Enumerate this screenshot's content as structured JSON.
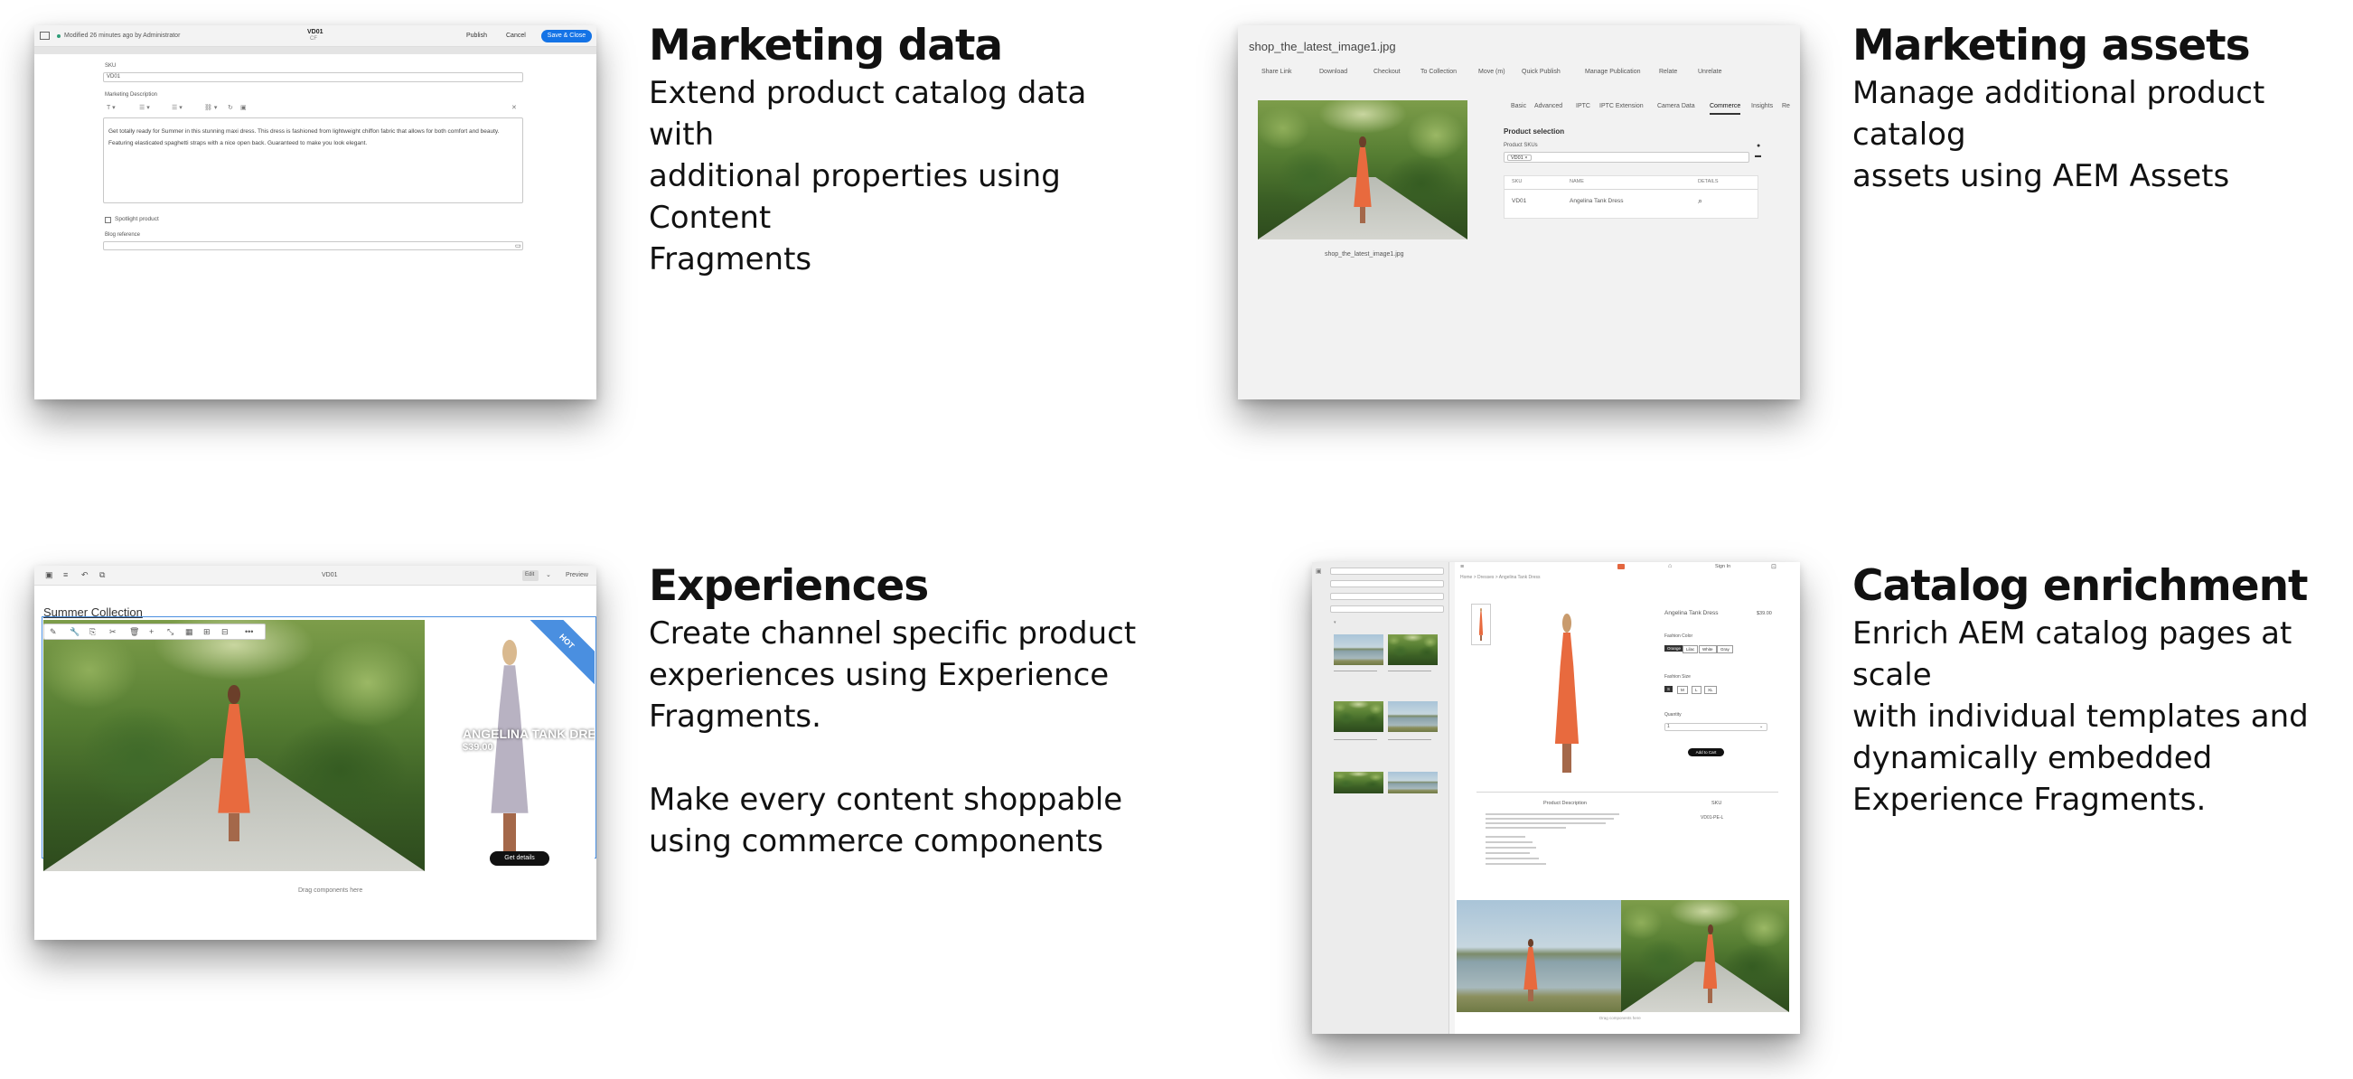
{
  "features": [
    {
      "id": "marketing-data",
      "title": "Marketing data",
      "body": [
        "Extend product catalog data with",
        "additional properties using Content",
        "Fragments"
      ]
    },
    {
      "id": "marketing-assets",
      "title": "Marketing assets",
      "body": [
        "Manage additional product catalog",
        "assets using AEM Assets"
      ]
    },
    {
      "id": "experiences",
      "title": "Experiences",
      "body": [
        "Create channel specific product",
        "experiences using Experience",
        "Fragments."
      ],
      "body2": [
        "Make every content shoppable",
        "using commerce components"
      ]
    },
    {
      "id": "catalog-enrichment",
      "title": "Catalog enrichment",
      "body": [
        "Enrich AEM catalog pages at scale",
        "with individual templates and",
        "dynamically embedded",
        "Experience Fragments."
      ]
    }
  ],
  "shot1": {
    "modified": "Modified 26 minutes ago by Administrator",
    "doc_title": "VD01",
    "doc_sub": "CF",
    "publish": "Publish",
    "cancel": "Cancel",
    "save_close": "Save & Close",
    "sku_label": "SKU",
    "sku_value": "VD01",
    "desc_label": "Marketing Description",
    "description": [
      "Get totally ready for Summer in this stunning maxi dress. This dress is fashioned from lightweight chiffon fabric that allows for both comfort and beauty.",
      "Featuring elasticated spaghetti straps with a nice open back. Guaranteed to make you look elegant."
    ],
    "spotlight": "Spotlight product",
    "blog_label": "Blog reference"
  },
  "shot2": {
    "filename": "shop_the_latest_image1.jpg",
    "toolbar": [
      "Share Link",
      "Download",
      "Checkout",
      "To Collection",
      "Move (m)",
      "Quick Publish",
      "Manage Publication",
      "Relate",
      "Unrelate"
    ],
    "caption": "shop_the_latest_image1.jpg",
    "tabs": [
      "Basic",
      "Advanced",
      "IPTC",
      "IPTC Extension",
      "Camera Data",
      "Commerce",
      "Insights",
      "Re"
    ],
    "active_tab": "Commerce",
    "section": "Product selection",
    "skus_label": "Product SKUs",
    "chip": "VD01",
    "col_sku": "SKU",
    "col_name": "NAME",
    "col_details": "DETAILS",
    "row_sku": "VD01",
    "row_name": "Angelina Tank Dress"
  },
  "shot3": {
    "title": "VD01",
    "edit": "Edit",
    "preview": "Preview",
    "collection": "Summer Collection",
    "promo": "ANGELINA TANK DRESS",
    "price": "$39.00",
    "ribbon": "HOT",
    "cta": "Get details",
    "drag": "Drag components here"
  },
  "shot4": {
    "signin": "Sign In",
    "breadcrumb": "Home > Dresses > Angelina Tank Dress",
    "product_title": "Angelina Tank Dress",
    "price": "$39.00",
    "color_label": "Fashion Color",
    "colors": [
      "Orange",
      "Lilac",
      "White",
      "Gray"
    ],
    "size_label": "Fashion Size",
    "sizes": [
      "S",
      "M",
      "L",
      "XL"
    ],
    "qty_label": "Quantity",
    "qty": "1",
    "add_to_cart": "Add to Cart",
    "desc_head": "Product Description",
    "sku_head": "SKU",
    "sku_value": "VD01-PE-L",
    "drag": "Drag components here"
  }
}
